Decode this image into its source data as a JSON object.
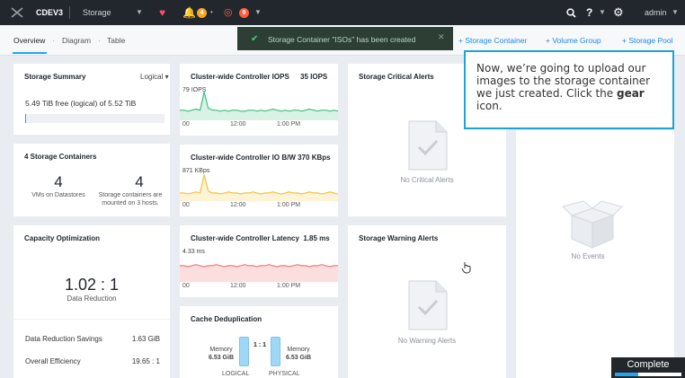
{
  "topbar": {
    "cluster": "CDEV3",
    "section": "Storage",
    "alert_count": "4",
    "critical_count": "9",
    "user": "admin"
  },
  "subnav": {
    "tabs": [
      "Overview",
      "Diagram",
      "Table"
    ],
    "actions": [
      "+ Storage Container",
      "+ Volume Group",
      "+ Storage Pool"
    ]
  },
  "toast": {
    "message": "Storage Container \"ISOs\" has been created"
  },
  "storage_summary": {
    "title": "Storage Summary",
    "view": "Logical",
    "free_text": "5.49 TiB free (logical) of 5.52 TiB",
    "used_fraction": 0.005
  },
  "containers": {
    "title": "4 Storage Containers",
    "count_left": "4",
    "caption_left": "VMs on Datastores",
    "count_right": "4",
    "caption_right_1": "Storage containers are",
    "caption_right_2": "mounted on 3 hosts."
  },
  "capacity": {
    "title": "Capacity Optimization",
    "ratio": "1.02 : 1",
    "caption": "Data Reduction",
    "rows": [
      {
        "label": "Data Reduction Savings",
        "value": "1.63 GiB"
      },
      {
        "label": "Overall Efficiency",
        "value": "19.65 : 1"
      }
    ]
  },
  "iops": {
    "title": "Cluster-wide Controller IOPS",
    "value": "35 IOPS",
    "ymax": "79 IOPS",
    "x_ticks": [
      "00",
      "12:00",
      "1:00 PM"
    ],
    "color": "#3fbf7f",
    "fill": "#d9f2e5",
    "series": [
      10,
      10,
      9,
      10,
      11,
      10,
      28,
      12,
      10,
      10,
      9,
      10,
      9,
      10,
      10,
      9,
      9,
      10,
      10,
      9,
      10,
      9,
      10,
      11,
      10,
      9,
      10,
      9,
      10,
      10,
      9,
      10,
      11,
      10,
      9,
      10,
      10,
      9,
      10,
      9
    ]
  },
  "io_bw": {
    "title": "Cluster-wide Controller IO B/W",
    "value": "370 KBps",
    "ymax": "871 KBps",
    "x_ticks": [
      "00",
      "12:00",
      "1:00 PM"
    ],
    "color": "#f5c242",
    "fill": "#fdf3d6",
    "series": [
      8,
      8,
      7,
      8,
      9,
      8,
      26,
      10,
      8,
      8,
      7,
      8,
      9,
      8,
      8,
      7,
      8,
      8,
      9,
      8,
      7,
      8,
      8,
      9,
      8,
      7,
      8,
      9,
      8,
      8,
      7,
      8,
      9,
      8,
      8,
      7,
      8,
      9,
      8,
      7
    ]
  },
  "latency": {
    "title": "Cluster-wide Controller Latency",
    "value": "1.85 ms",
    "ymax": "4.33 ms",
    "x_ticks": [
      "00",
      "12:00",
      "1:00 PM"
    ],
    "color": "#f07a7a",
    "fill": "#fcdede",
    "series": [
      16,
      16,
      15,
      16,
      17,
      16,
      15,
      16,
      16,
      17,
      16,
      15,
      16,
      16,
      15,
      16,
      17,
      16,
      16,
      15,
      16,
      16,
      17,
      16,
      15,
      16,
      16,
      15,
      16,
      17,
      16,
      16,
      15,
      16,
      16,
      17,
      16,
      15,
      16,
      16
    ]
  },
  "cache_dedup": {
    "title": "Cache Deduplication",
    "left_label": "Memory",
    "left_value": "6.53 GiB",
    "ratio": "1 : 1",
    "right_label": "Memory",
    "right_value": "6.53 GiB",
    "logical": "LOGICAL",
    "physical": "PHYSICAL"
  },
  "critical_alerts": {
    "title": "Storage Critical Alerts",
    "empty": "No Critical Alerts"
  },
  "warning_alerts": {
    "title": "Storage Warning Alerts",
    "empty": "No Warning Alerts"
  },
  "events": {
    "empty": "No Events"
  },
  "tooltip": {
    "text": "Now, we’re going to upload our images to the storage container we just created. Click the ",
    "keyword": "gear",
    "suffix": " icon."
  },
  "progress": {
    "label": "Complete",
    "fraction": 0.35
  },
  "icons": [
    "nutanix-logo-icon",
    "heart-icon",
    "bell-icon",
    "circle-icon",
    "search-icon",
    "help-icon",
    "gear-icon",
    "check-icon",
    "close-icon",
    "document-icon",
    "box-icon",
    "cursor-icon"
  ]
}
